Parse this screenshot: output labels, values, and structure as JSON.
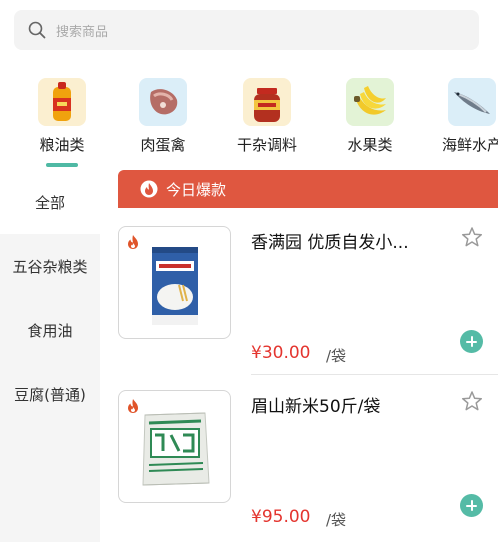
{
  "search": {
    "placeholder": "搜索商品",
    "icon": "search-icon"
  },
  "categories": [
    {
      "label": "粮油类",
      "icon": "cooking-oil-icon",
      "active": true
    },
    {
      "label": "肉蛋禽",
      "icon": "meat-icon"
    },
    {
      "label": "干杂调料",
      "icon": "sauce-jar-icon"
    },
    {
      "label": "水果类",
      "icon": "banana-icon"
    },
    {
      "label": "海鲜水产",
      "icon": "fish-icon"
    }
  ],
  "sidebar": {
    "items": [
      {
        "label": "全部",
        "active": true
      },
      {
        "label": "五谷杂粮类"
      },
      {
        "label": "食用油"
      },
      {
        "label": "豆腐(普通)"
      }
    ]
  },
  "banner": {
    "label": "今日爆款",
    "icon": "fire-icon"
  },
  "products": [
    {
      "name": "香满园 优质自发小...",
      "price": "¥30.00",
      "unit": "/袋",
      "image": "flour-bag-icon"
    },
    {
      "name": "眉山新米50斤/袋",
      "price": "¥95.00",
      "unit": "/袋",
      "image": "rice-sack-icon"
    }
  ],
  "colors": {
    "accent": "#55bba6",
    "banner": "#df5740",
    "price": "#e4352f"
  }
}
